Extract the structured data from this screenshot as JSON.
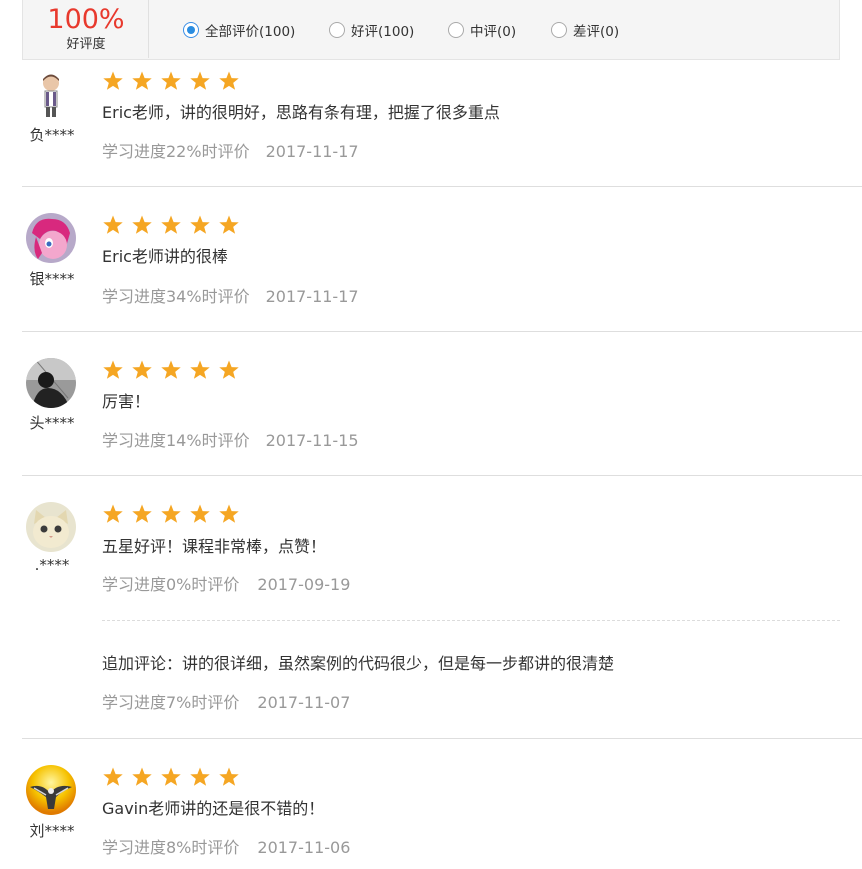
{
  "summary": {
    "rate": "100%",
    "rate_label": "好评度"
  },
  "filters": [
    {
      "label": "全部评价(100)",
      "selected": true
    },
    {
      "label": "好评(100)",
      "selected": false
    },
    {
      "label": "中评(0)",
      "selected": false
    },
    {
      "label": "差评(0)",
      "selected": false
    }
  ],
  "star_color": "#f5a623",
  "reviews": [
    {
      "user": "负****",
      "stars": 5,
      "content": "Eric老师，讲的很明好，思路有条有理，把握了很多重点",
      "progress": "学习进度22%时评价",
      "date": "2017-11-17"
    },
    {
      "user": "银****",
      "stars": 5,
      "content": "Eric老师讲的很棒",
      "progress": "学习进度34%时评价",
      "date": "2017-11-17"
    },
    {
      "user": "头****",
      "stars": 5,
      "content": "厉害！",
      "progress": "学习进度14%时评价",
      "date": "2017-11-15"
    },
    {
      "user": ".****",
      "stars": 5,
      "content": "五星好评！课程非常棒，点赞！",
      "progress": "学习进度0%时评价",
      "date": "2017-09-19",
      "followup": {
        "content": "追加评论：讲的很详细，虽然案例的代码很少，但是每一步都讲的很清楚",
        "progress": "学习进度7%时评价",
        "date": "2017-11-07"
      }
    },
    {
      "user": "刘****",
      "stars": 5,
      "content": "Gavin老师讲的还是很不错的！",
      "progress": "学习进度8%时评价",
      "date": "2017-11-06"
    }
  ]
}
